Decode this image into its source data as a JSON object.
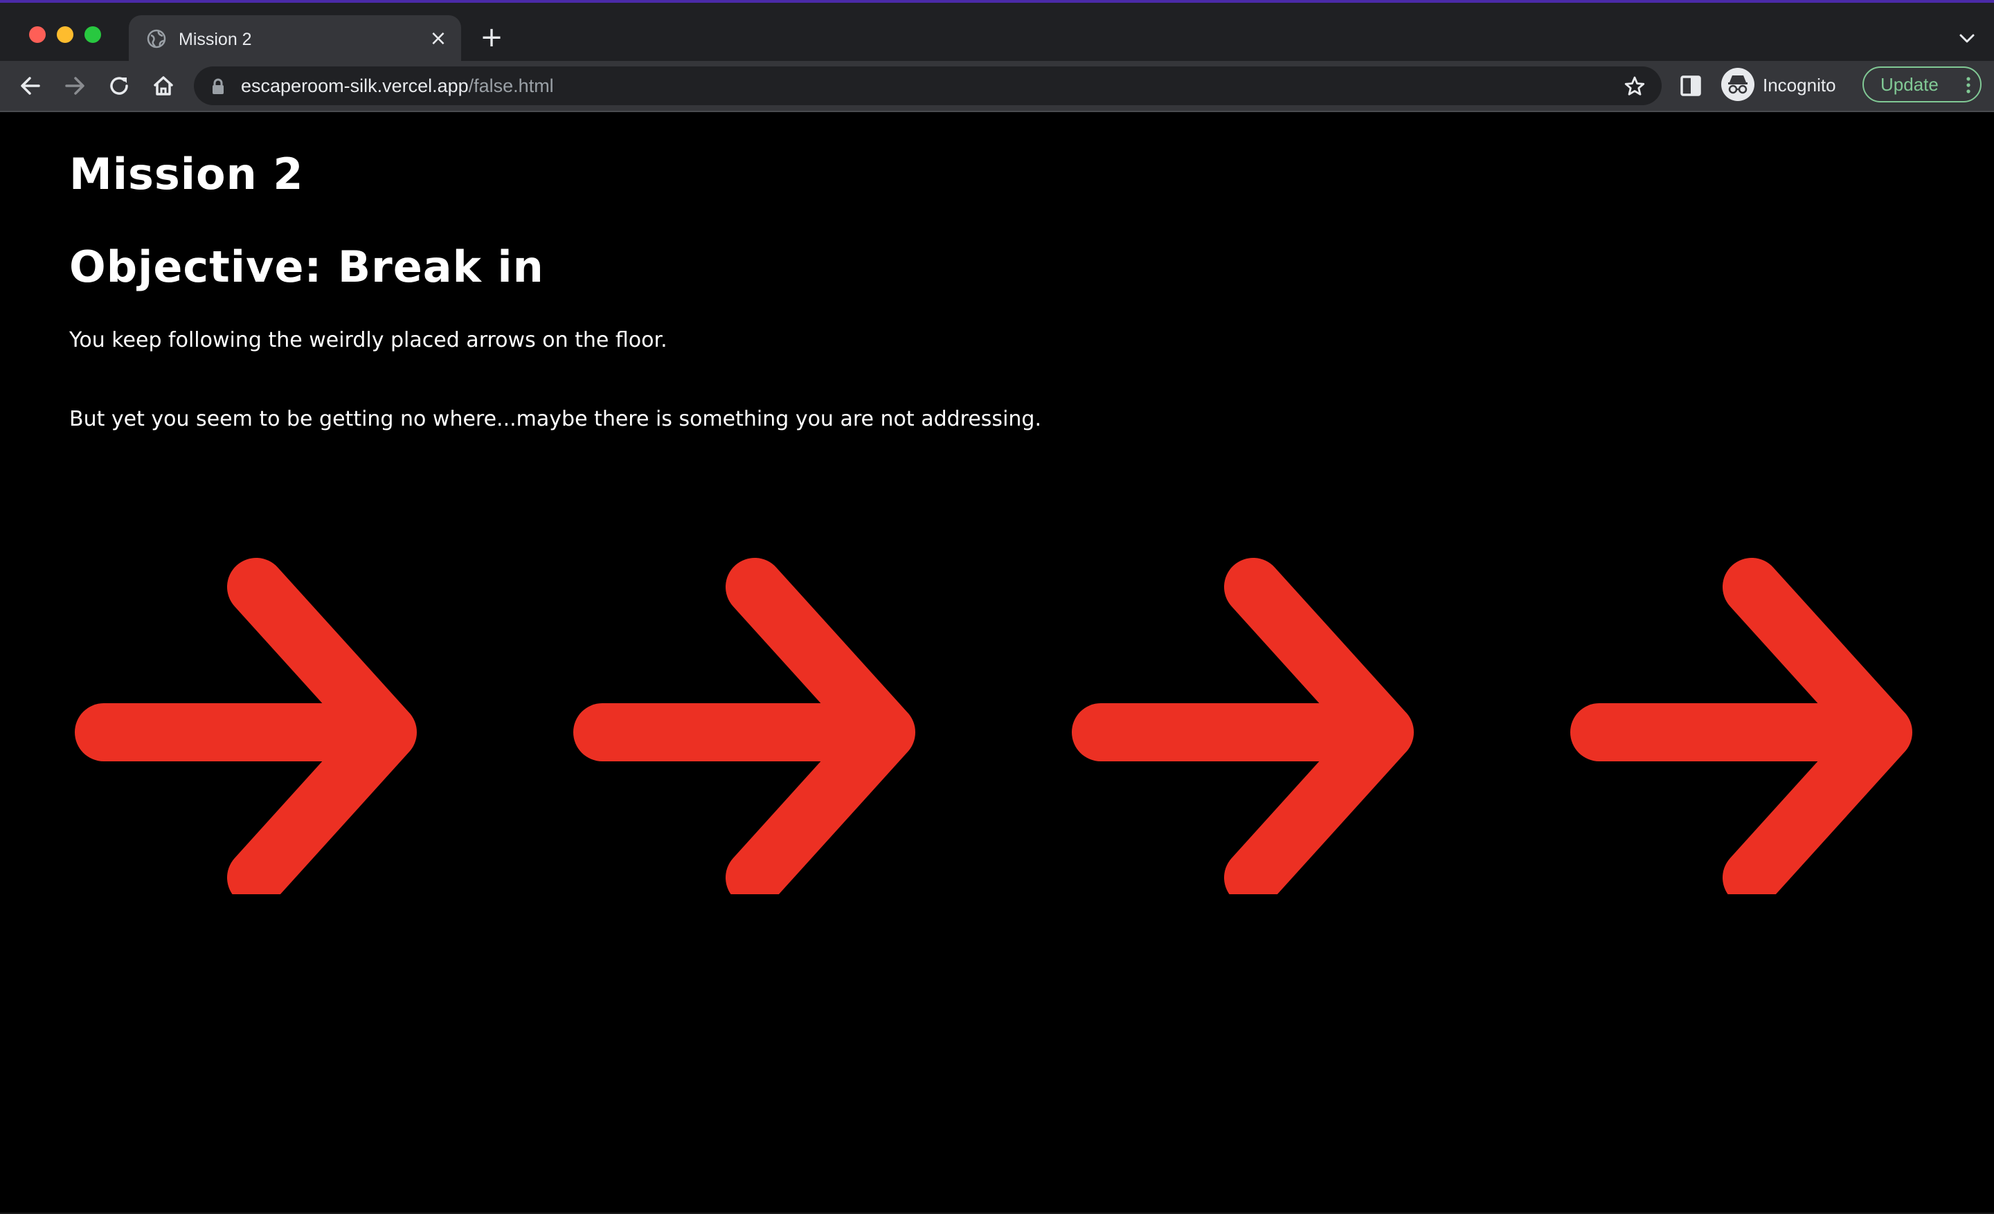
{
  "browser": {
    "tab": {
      "title": "Mission 2",
      "close_glyph": "×"
    },
    "new_tab_glyph": "+",
    "address": {
      "domain": "escaperoom-silk.vercel.app",
      "path": "/false.html"
    },
    "profile_label": "Incognito",
    "update_label": "Update"
  },
  "page": {
    "mission_title": "Mission 2",
    "objective": "Objective: Break in",
    "paragraph_1": "You keep following the weirdly placed arrows on the floor.",
    "paragraph_2": "But yet you seem to be getting no where...maybe there is something you are not addressing."
  },
  "colors": {
    "arrow": "#ec3023",
    "background": "#000000",
    "update_accent": "#81c995"
  },
  "icons": {
    "arrows": [
      "arrow-right-icon",
      "arrow-right-icon",
      "arrow-right-icon",
      "arrow-right-icon"
    ]
  }
}
